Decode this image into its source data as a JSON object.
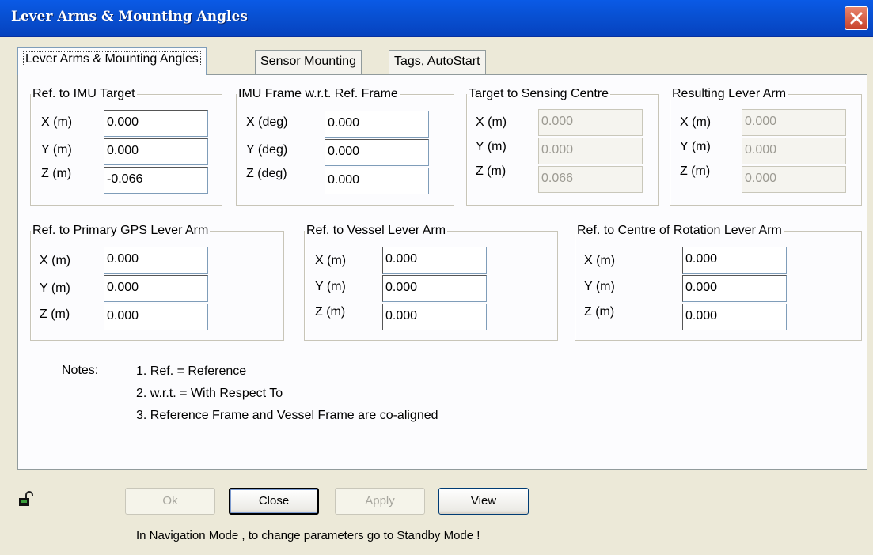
{
  "window": {
    "title": "Lever Arms & Mounting Angles"
  },
  "tabs": [
    {
      "label": "Lever Arms & Mounting Angles",
      "active": true
    },
    {
      "label": "Sensor Mounting",
      "active": false
    },
    {
      "label": "Tags, AutoStart",
      "active": false
    }
  ],
  "groups": {
    "imu_target": {
      "title": "Ref. to IMU Target",
      "x_label": "X (m)",
      "y_label": "Y (m)",
      "z_label": "Z (m)",
      "x": "0.000",
      "y": "0.000",
      "z": "-0.066"
    },
    "imu_frame": {
      "title": "IMU Frame w.r.t. Ref. Frame",
      "x_label": "X (deg)",
      "y_label": "Y (deg)",
      "z_label": "Z (deg)",
      "x": "0.000",
      "y": "0.000",
      "z": "0.000"
    },
    "target_sensing": {
      "title": "Target to Sensing Centre",
      "x_label": "X (m)",
      "y_label": "Y (m)",
      "z_label": "Z (m)",
      "x": "0.000",
      "y": "0.000",
      "z": "0.066"
    },
    "resulting": {
      "title": "Resulting Lever Arm",
      "x_label": "X (m)",
      "y_label": "Y (m)",
      "z_label": "Z (m)",
      "x": "0.000",
      "y": "0.000",
      "z": "0.000"
    },
    "primary_gps": {
      "title": "Ref. to Primary GPS Lever Arm",
      "x_label": "X (m)",
      "y_label": "Y (m)",
      "z_label": "Z (m)",
      "x": "0.000",
      "y": "0.000",
      "z": "0.000"
    },
    "vessel": {
      "title": "Ref. to Vessel Lever Arm",
      "x_label": "X (m)",
      "y_label": "Y (m)",
      "z_label": "Z (m)",
      "x": "0.000",
      "y": "0.000",
      "z": "0.000"
    },
    "rotation": {
      "title": "Ref. to Centre of Rotation Lever Arm",
      "x_label": "X (m)",
      "y_label": "Y (m)",
      "z_label": "Z (m)",
      "x": "0.000",
      "y": "0.000",
      "z": "0.000"
    }
  },
  "notes": {
    "heading": "Notes:",
    "items": [
      "1. Ref. = Reference",
      "2. w.r.t. = With Respect To",
      "3. Reference Frame and Vessel Frame are co-aligned"
    ]
  },
  "buttons": {
    "ok": "Ok",
    "close": "Close",
    "apply": "Apply",
    "view": "View"
  },
  "status": "In Navigation Mode , to change parameters go to Standby Mode !",
  "icons": {
    "lock": "unlocked-padlock-icon",
    "close": "close-icon"
  }
}
